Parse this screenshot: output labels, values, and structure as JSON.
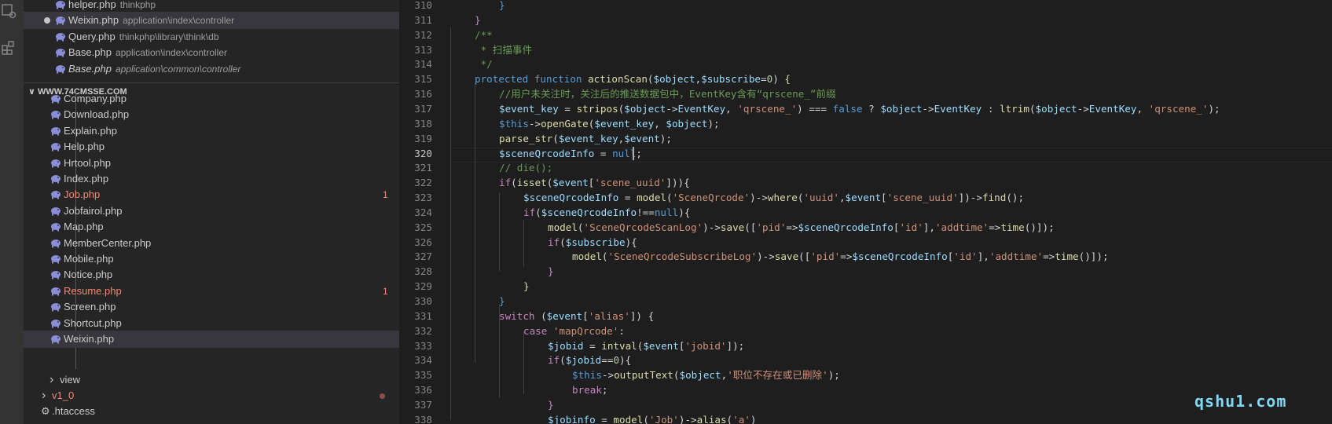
{
  "open_editors": [
    {
      "name": "helper.php",
      "path": "thinkphp",
      "italic": false,
      "selected": false,
      "modified": false
    },
    {
      "name": "Weixin.php",
      "path": "application\\index\\controller",
      "italic": false,
      "selected": true,
      "modified": true
    },
    {
      "name": "Query.php",
      "path": "thinkphp\\library\\think\\db",
      "italic": false,
      "selected": false,
      "modified": false
    },
    {
      "name": "Base.php",
      "path": "application\\index\\controller",
      "italic": false,
      "selected": false,
      "modified": false
    },
    {
      "name": "Base.php",
      "path": "application\\common\\controller",
      "italic": true,
      "selected": false,
      "modified": false
    }
  ],
  "workspace_title": "WWW.74CMSSE.COM",
  "files": [
    {
      "name": "Company.php",
      "error": false,
      "badge": ""
    },
    {
      "name": "Download.php",
      "error": false,
      "badge": ""
    },
    {
      "name": "Explain.php",
      "error": false,
      "badge": ""
    },
    {
      "name": "Help.php",
      "error": false,
      "badge": ""
    },
    {
      "name": "Hrtool.php",
      "error": false,
      "badge": ""
    },
    {
      "name": "Index.php",
      "error": false,
      "badge": ""
    },
    {
      "name": "Job.php",
      "error": true,
      "badge": "1"
    },
    {
      "name": "Jobfairol.php",
      "error": false,
      "badge": ""
    },
    {
      "name": "Map.php",
      "error": false,
      "badge": ""
    },
    {
      "name": "MemberCenter.php",
      "error": false,
      "badge": ""
    },
    {
      "name": "Mobile.php",
      "error": false,
      "badge": ""
    },
    {
      "name": "Notice.php",
      "error": false,
      "badge": ""
    },
    {
      "name": "Resume.php",
      "error": true,
      "badge": "1"
    },
    {
      "name": "Screen.php",
      "error": false,
      "badge": ""
    },
    {
      "name": "Shortcut.php",
      "error": false,
      "badge": ""
    },
    {
      "name": "Weixin.php",
      "error": false,
      "badge": "",
      "selected": true
    }
  ],
  "folders": [
    {
      "name": "view",
      "error": false
    },
    {
      "name": "v1_0",
      "error": true
    },
    {
      "name": ".htaccess",
      "error": false,
      "is_file": true
    }
  ],
  "code_lines": [
    {
      "num": 310,
      "indent": 2,
      "tokens": [
        [
          "}",
          "k"
        ]
      ]
    },
    {
      "num": 311,
      "indent": 1,
      "tokens": [
        [
          "}",
          "p"
        ]
      ]
    },
    {
      "num": 312,
      "indent": 1,
      "tokens": [
        [
          "/**",
          "c"
        ]
      ]
    },
    {
      "num": 313,
      "indent": 1,
      "tokens": [
        [
          " * 扫描事件",
          "c"
        ]
      ]
    },
    {
      "num": 314,
      "indent": 1,
      "tokens": [
        [
          " */",
          "c"
        ]
      ]
    },
    {
      "num": 315,
      "indent": 1,
      "tokens": [
        [
          "protected ",
          "k"
        ],
        [
          "function ",
          "k"
        ],
        [
          "actionScan",
          "f"
        ],
        [
          "(",
          "o"
        ],
        [
          "$object",
          "v"
        ],
        [
          ",",
          "o"
        ],
        [
          "$subscribe",
          "v"
        ],
        [
          "=",
          "o"
        ],
        [
          "0",
          "n"
        ],
        [
          ") ",
          "o"
        ],
        [
          "{",
          "f"
        ]
      ]
    },
    {
      "num": 316,
      "indent": 2,
      "tokens": [
        [
          "//用户未关注时，关注后的推送数据包中，EventKey含有“qrscene_”前缀",
          "c"
        ]
      ]
    },
    {
      "num": 317,
      "indent": 2,
      "tokens": [
        [
          "$event_key",
          "v"
        ],
        [
          " = ",
          "o"
        ],
        [
          "stripos",
          "f"
        ],
        [
          "(",
          "o"
        ],
        [
          "$object",
          "v"
        ],
        [
          "->",
          "o"
        ],
        [
          "EventKey",
          "v"
        ],
        [
          ", ",
          "o"
        ],
        [
          "'qrscene_'",
          "s"
        ],
        [
          ") === ",
          "o"
        ],
        [
          "false",
          "k"
        ],
        [
          " ? ",
          "o"
        ],
        [
          "$object",
          "v"
        ],
        [
          "->",
          "o"
        ],
        [
          "EventKey",
          "v"
        ],
        [
          " : ",
          "o"
        ],
        [
          "ltrim",
          "f"
        ],
        [
          "(",
          "o"
        ],
        [
          "$object",
          "v"
        ],
        [
          "->",
          "o"
        ],
        [
          "EventKey",
          "v"
        ],
        [
          ", ",
          "o"
        ],
        [
          "'qrscene_'",
          "s"
        ],
        [
          ");",
          "o"
        ]
      ]
    },
    {
      "num": 318,
      "indent": 2,
      "tokens": [
        [
          "$this",
          "k"
        ],
        [
          "->",
          "o"
        ],
        [
          "openGate",
          "f"
        ],
        [
          "(",
          "o"
        ],
        [
          "$event_key",
          "v"
        ],
        [
          ", ",
          "o"
        ],
        [
          "$object",
          "v"
        ],
        [
          ");",
          "o"
        ]
      ]
    },
    {
      "num": 319,
      "indent": 2,
      "tokens": [
        [
          "parse_str",
          "f"
        ],
        [
          "(",
          "o"
        ],
        [
          "$event_key",
          "v"
        ],
        [
          ",",
          "o"
        ],
        [
          "$event",
          "v"
        ],
        [
          ");",
          "o"
        ]
      ]
    },
    {
      "num": 320,
      "indent": 2,
      "tokens": [
        [
          "$sceneQrcodeInfo",
          "v"
        ],
        [
          " = ",
          "o"
        ],
        [
          "null",
          "k"
        ],
        [
          ";",
          "o"
        ]
      ]
    },
    {
      "num": 321,
      "indent": 2,
      "tokens": [
        [
          "// die();",
          "c"
        ]
      ]
    },
    {
      "num": 322,
      "indent": 2,
      "tokens": [
        [
          "if",
          "p"
        ],
        [
          "(",
          "o"
        ],
        [
          "isset",
          "f"
        ],
        [
          "(",
          "o"
        ],
        [
          "$event",
          "v"
        ],
        [
          "[",
          "o"
        ],
        [
          "'scene_uuid'",
          "s"
        ],
        [
          "])){",
          "o"
        ]
      ]
    },
    {
      "num": 323,
      "indent": 3,
      "tokens": [
        [
          "$sceneQrcodeInfo",
          "v"
        ],
        [
          " = ",
          "o"
        ],
        [
          "model",
          "f"
        ],
        [
          "(",
          "o"
        ],
        [
          "'SceneQrcode'",
          "s"
        ],
        [
          ")->",
          "o"
        ],
        [
          "where",
          "f"
        ],
        [
          "(",
          "o"
        ],
        [
          "'uuid'",
          "s"
        ],
        [
          ",",
          "o"
        ],
        [
          "$event",
          "v"
        ],
        [
          "[",
          "o"
        ],
        [
          "'scene_uuid'",
          "s"
        ],
        [
          "])->",
          "o"
        ],
        [
          "find",
          "f"
        ],
        [
          "();",
          "o"
        ]
      ]
    },
    {
      "num": 324,
      "indent": 3,
      "tokens": [
        [
          "if",
          "p"
        ],
        [
          "(",
          "o"
        ],
        [
          "$sceneQrcodeInfo",
          "v"
        ],
        [
          "!==",
          "o"
        ],
        [
          "null",
          "k"
        ],
        [
          "){",
          "o"
        ]
      ]
    },
    {
      "num": 325,
      "indent": 4,
      "tokens": [
        [
          "model",
          "f"
        ],
        [
          "(",
          "o"
        ],
        [
          "'SceneQrcodeScanLog'",
          "s"
        ],
        [
          ")->",
          "o"
        ],
        [
          "save",
          "f"
        ],
        [
          "([",
          "o"
        ],
        [
          "'pid'",
          "s"
        ],
        [
          "=>",
          "o"
        ],
        [
          "$sceneQrcodeInfo",
          "v"
        ],
        [
          "[",
          "o"
        ],
        [
          "'id'",
          "s"
        ],
        [
          "],",
          "o"
        ],
        [
          "'addtime'",
          "s"
        ],
        [
          "=>",
          "o"
        ],
        [
          "time",
          "f"
        ],
        [
          "()]);",
          "o"
        ]
      ]
    },
    {
      "num": 326,
      "indent": 4,
      "tokens": [
        [
          "if",
          "p"
        ],
        [
          "(",
          "o"
        ],
        [
          "$subscribe",
          "v"
        ],
        [
          "){",
          "o"
        ]
      ]
    },
    {
      "num": 327,
      "indent": 5,
      "tokens": [
        [
          "model",
          "f"
        ],
        [
          "(",
          "o"
        ],
        [
          "'SceneQrcodeSubscribeLog'",
          "s"
        ],
        [
          ")->",
          "o"
        ],
        [
          "save",
          "f"
        ],
        [
          "([",
          "o"
        ],
        [
          "'pid'",
          "s"
        ],
        [
          "=>",
          "o"
        ],
        [
          "$sceneQrcodeInfo",
          "v"
        ],
        [
          "[",
          "o"
        ],
        [
          "'id'",
          "s"
        ],
        [
          "],",
          "o"
        ],
        [
          "'addtime'",
          "s"
        ],
        [
          "=>",
          "o"
        ],
        [
          "time",
          "f"
        ],
        [
          "()]);",
          "o"
        ]
      ]
    },
    {
      "num": 328,
      "indent": 4,
      "tokens": [
        [
          "}",
          "p"
        ]
      ]
    },
    {
      "num": 329,
      "indent": 3,
      "tokens": [
        [
          "}",
          "f"
        ]
      ]
    },
    {
      "num": 330,
      "indent": 2,
      "tokens": [
        [
          "}",
          "k"
        ]
      ]
    },
    {
      "num": 331,
      "indent": 2,
      "tokens": [
        [
          "switch",
          "p"
        ],
        [
          " (",
          "o"
        ],
        [
          "$event",
          "v"
        ],
        [
          "[",
          "o"
        ],
        [
          "'alias'",
          "s"
        ],
        [
          "]) {",
          "o"
        ]
      ]
    },
    {
      "num": 332,
      "indent": 3,
      "tokens": [
        [
          "case ",
          "p"
        ],
        [
          "'mapQrcode'",
          "s"
        ],
        [
          ":",
          "o"
        ]
      ]
    },
    {
      "num": 333,
      "indent": 4,
      "tokens": [
        [
          "$jobid",
          "v"
        ],
        [
          " = ",
          "o"
        ],
        [
          "intval",
          "f"
        ],
        [
          "(",
          "o"
        ],
        [
          "$event",
          "v"
        ],
        [
          "[",
          "o"
        ],
        [
          "'jobid'",
          "s"
        ],
        [
          "]);",
          "o"
        ]
      ]
    },
    {
      "num": 334,
      "indent": 4,
      "tokens": [
        [
          "if",
          "p"
        ],
        [
          "(",
          "o"
        ],
        [
          "$jobid",
          "v"
        ],
        [
          "==",
          "o"
        ],
        [
          "0",
          "n"
        ],
        [
          "){",
          "o"
        ]
      ]
    },
    {
      "num": 335,
      "indent": 5,
      "tokens": [
        [
          "$this",
          "k"
        ],
        [
          "->",
          "o"
        ],
        [
          "outputText",
          "f"
        ],
        [
          "(",
          "o"
        ],
        [
          "$object",
          "v"
        ],
        [
          ",",
          "o"
        ],
        [
          "'职位不存在或已删除'",
          "s"
        ],
        [
          ");",
          "o"
        ]
      ]
    },
    {
      "num": 336,
      "indent": 5,
      "tokens": [
        [
          "break",
          "p"
        ],
        [
          ";",
          "o"
        ]
      ]
    },
    {
      "num": 337,
      "indent": 4,
      "tokens": [
        [
          "}",
          "p"
        ]
      ]
    },
    {
      "num": 338,
      "indent": 4,
      "tokens": [
        [
          "$jobinfo",
          "v"
        ],
        [
          " = ",
          "o"
        ],
        [
          "model",
          "f"
        ],
        [
          "(",
          "o"
        ],
        [
          "'Job'",
          "s"
        ],
        [
          ")->",
          "o"
        ],
        [
          "alias",
          "f"
        ],
        [
          "(",
          "o"
        ],
        [
          "'a'",
          "s"
        ],
        [
          ")",
          "o"
        ]
      ]
    }
  ],
  "current_line": 320,
  "watermark": "qshu1.com"
}
